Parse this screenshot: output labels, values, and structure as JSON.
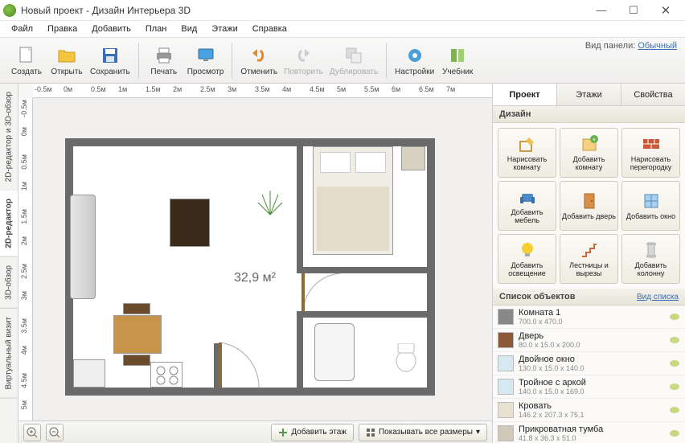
{
  "window": {
    "title": "Новый проект - Дизайн Интерьера 3D",
    "viewpanel_label": "Вид панели:",
    "viewpanel_mode": "Обычный"
  },
  "menu": [
    "Файл",
    "Правка",
    "Добавить",
    "План",
    "Вид",
    "Этажи",
    "Справка"
  ],
  "toolbar": {
    "create": "Создать",
    "open": "Открыть",
    "save": "Сохранить",
    "print": "Печать",
    "view": "Просмотр",
    "undo": "Отменить",
    "redo": "Повторить",
    "duplicate": "Дублировать",
    "settings": "Настройки",
    "book": "Учебник"
  },
  "lefttabs": {
    "combo": "2D-редактор и 3D-обзор",
    "editor2d": "2D-редактор",
    "view3d": "3D-обзор",
    "virtual": "Виртуальный визит"
  },
  "ruler_h": [
    "-0.5м",
    "0м",
    "0.5м",
    "1м",
    "1.5м",
    "2м",
    "2.5м",
    "3м",
    "3.5м",
    "4м",
    "4.5м",
    "5м",
    "5.5м",
    "6м",
    "6.5м",
    "7м"
  ],
  "ruler_v": [
    "-0.5м",
    "0м",
    "0.5м",
    "1м",
    "1.5м",
    "2м",
    "2.5м",
    "3м",
    "3.5м",
    "4м",
    "4.5м",
    "5м"
  ],
  "plan": {
    "area": "32,9 м²"
  },
  "bottom": {
    "add_floor": "Добавить этаж",
    "show_all": "Показывать все размеры"
  },
  "right": {
    "tabs": {
      "project": "Проект",
      "floors": "Этажи",
      "props": "Свойства"
    },
    "design": "Дизайн",
    "tools": [
      "Нарисовать комнату",
      "Добавить комнату",
      "Нарисовать перегородку",
      "Добавить мебель",
      "Добавить дверь",
      "Добавить окно",
      "Добавить освещение",
      "Лестницы и вырезы",
      "Добавить колонну"
    ],
    "objects_title": "Список объектов",
    "view_mode": "Вид списка",
    "objects": [
      {
        "name": "Комната 1",
        "dims": "700.0 x 470.0"
      },
      {
        "name": "Дверь",
        "dims": "80.0 x 15.0 x 200.0"
      },
      {
        "name": "Двойное окно",
        "dims": "130.0 x 15.0 x 140.0"
      },
      {
        "name": "Тройное с аркой",
        "dims": "140.0 x 15.0 x 169.0"
      },
      {
        "name": "Кровать",
        "dims": "146.2 x 207.3 x 75.1"
      },
      {
        "name": "Прикроватная тумба",
        "dims": "41.8 x 36.3 x 51.0"
      }
    ]
  }
}
